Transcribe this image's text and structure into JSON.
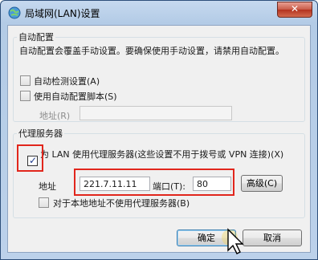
{
  "window": {
    "title": "局域网(LAN)设置",
    "close_label": "✕"
  },
  "auto_config": {
    "legend": "自动配置",
    "description": "自动配置会覆盖手动设置。要确保使用手动设置，请禁用自动配置。",
    "auto_detect_label": "自动检测设置(A)",
    "auto_detect_checked": false,
    "use_script_label": "使用自动配置脚本(S)",
    "use_script_checked": false,
    "address_label": "地址(R)",
    "address_value": ""
  },
  "proxy": {
    "legend": "代理服务器",
    "use_proxy_label": "为 LAN 使用代理服务器(这些设置不用于拨号或 VPN 连接)(X)",
    "use_proxy_checked": true,
    "address_label": "地址",
    "address_value": "221.7.11.11",
    "port_label": "端口(T):",
    "port_value": "80",
    "advanced_label": "高级(C)",
    "bypass_local_label": "对于本地地址不使用代理服务器(B)",
    "bypass_local_checked": false
  },
  "footer": {
    "ok_label": "确定",
    "cancel_label": "取消"
  },
  "colors": {
    "highlight_red": "#e1261c",
    "title_bar": "#b9cfe9"
  },
  "icons": {
    "window": "globe-network-icon",
    "cursor": "mouse-pointer-icon"
  }
}
